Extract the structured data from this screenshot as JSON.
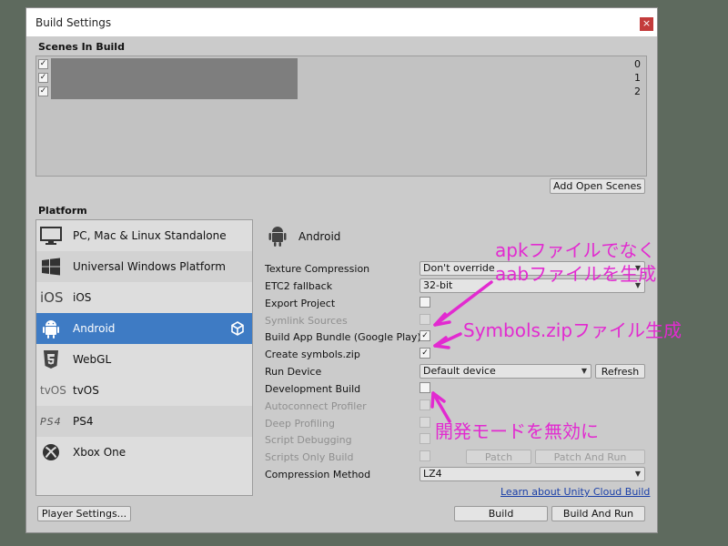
{
  "window": {
    "title": "Build Settings",
    "close_glyph": "×"
  },
  "scenes": {
    "label": "Scenes In Build",
    "rows": [
      {
        "checked": "✓",
        "index": "0"
      },
      {
        "checked": "✓",
        "index": "1"
      },
      {
        "checked": "✓",
        "index": "2"
      }
    ],
    "add_open_scenes": "Add Open Scenes"
  },
  "platform": {
    "label": "Platform",
    "items": [
      {
        "label": "PC, Mac & Linux Standalone",
        "icon": "monitor-icon"
      },
      {
        "label": "Universal Windows Platform",
        "icon": "windows-icon"
      },
      {
        "label": "iOS",
        "icon_text": "iOS"
      },
      {
        "label": "Android",
        "icon": "android-icon"
      },
      {
        "label": "WebGL",
        "icon": "html5-icon"
      },
      {
        "label": "tvOS",
        "icon_text": "tvOS"
      },
      {
        "label": "PS4",
        "icon_text": "PS4"
      },
      {
        "label": "Xbox One",
        "icon": "xbox-icon"
      }
    ]
  },
  "settings": {
    "header": "Android",
    "texture_compression": {
      "label": "Texture Compression",
      "value": "Don't override"
    },
    "etc2_fallback": {
      "label": "ETC2 fallback",
      "value": "32-bit"
    },
    "export_project": {
      "label": "Export Project"
    },
    "symlink_sources": {
      "label": "Symlink Sources"
    },
    "build_app_bundle": {
      "label": "Build App Bundle (Google Play)",
      "mark": "✓"
    },
    "create_symbols": {
      "label": "Create symbols.zip",
      "mark": "✓"
    },
    "run_device": {
      "label": "Run Device",
      "value": "Default device",
      "refresh": "Refresh"
    },
    "development_build": {
      "label": "Development Build"
    },
    "autoconnect_profiler": {
      "label": "Autoconnect Profiler"
    },
    "deep_profiling": {
      "label": "Deep Profiling"
    },
    "script_debugging": {
      "label": "Script Debugging"
    },
    "scripts_only_build": {
      "label": "Scripts Only Build",
      "patch": "Patch",
      "patch_and_run": "Patch And Run"
    },
    "compression_method": {
      "label": "Compression Method",
      "value": "LZ4"
    }
  },
  "footer": {
    "cloud_link": "Learn about Unity Cloud Build",
    "player_settings": "Player Settings...",
    "build": "Build",
    "build_and_run": "Build And Run"
  },
  "annotations": {
    "apk_line1": "apkファイルでなく",
    "apk_line2": "aabファイルを生成",
    "symbols": "Symbols.zipファイル生成",
    "dev_mode": "開発モードを無効に",
    "color": "#e22ad0"
  }
}
